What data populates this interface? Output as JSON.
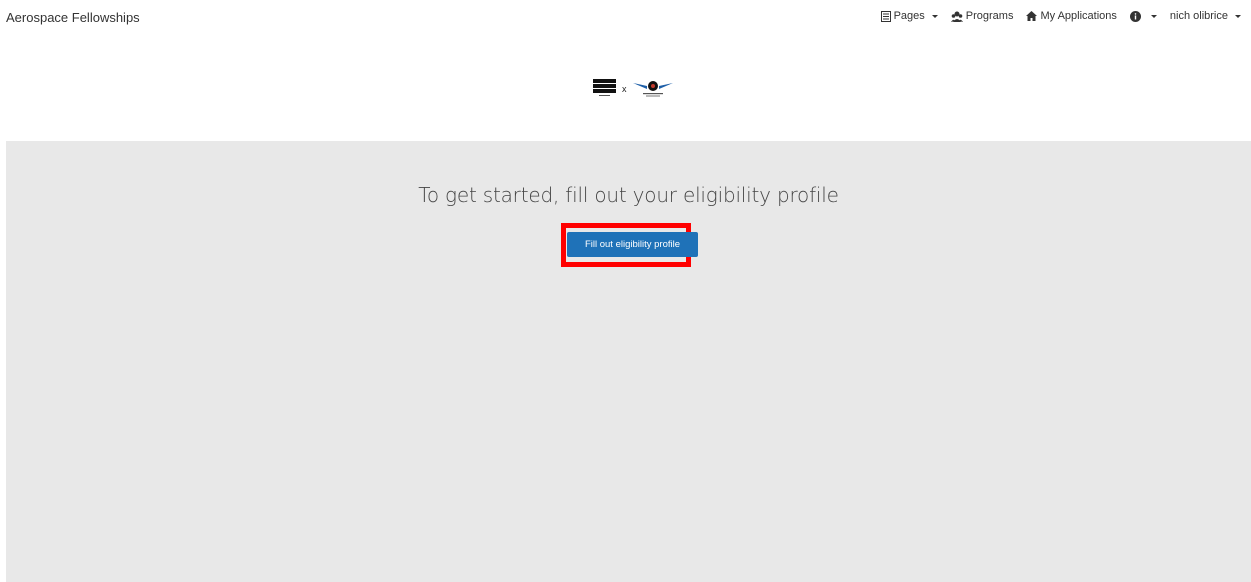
{
  "navbar": {
    "brand": "Aerospace Fellowships",
    "items": [
      {
        "label": "Pages",
        "icon": "file-icon",
        "has_caret": true
      },
      {
        "label": "Programs",
        "icon": "users-icon",
        "has_caret": false
      },
      {
        "label": "My Applications",
        "icon": "home-icon",
        "has_caret": false
      },
      {
        "label": "",
        "icon": "info-icon",
        "has_caret": true
      },
      {
        "label": "nich olibrice",
        "icon": "",
        "has_caret": true
      }
    ]
  },
  "logos": {
    "left_alt": "Patti Grace Smith logo",
    "separator": "x",
    "right_alt": "Fellowship wings logo"
  },
  "main": {
    "headline": "To get started, fill out your eligibility profile",
    "cta_label": "Fill out eligibility profile"
  },
  "colors": {
    "primary": "#1f72b8",
    "background": "#e8e8e8",
    "highlight": "#ff0000"
  }
}
